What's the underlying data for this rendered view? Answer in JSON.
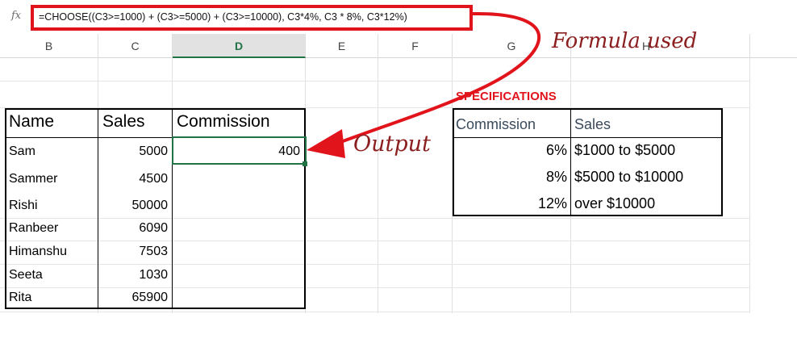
{
  "formula_bar": {
    "fx_label": "fx",
    "formula": "=CHOOSE((C3>=1000) + (C3>=5000) + (C3>=10000), C3*4%, C3 * 8%, C3*12%)"
  },
  "columns": [
    "B",
    "C",
    "D",
    "E",
    "F",
    "G",
    "H"
  ],
  "main_table": {
    "headers": {
      "name": "Name",
      "sales": "Sales",
      "commission": "Commission"
    },
    "rows": [
      {
        "name": "Sam",
        "sales": "5000",
        "commission": "400"
      },
      {
        "name": "Sammer",
        "sales": "4500",
        "commission": ""
      },
      {
        "name": "Rishi",
        "sales": "50000",
        "commission": ""
      },
      {
        "name": "Ranbeer",
        "sales": "6090",
        "commission": ""
      },
      {
        "name": "Himanshu",
        "sales": "7503",
        "commission": ""
      },
      {
        "name": "Seeta",
        "sales": "1030",
        "commission": ""
      },
      {
        "name": "Rita",
        "sales": "65900",
        "commission": ""
      }
    ]
  },
  "specifications": {
    "title": "SPECIFICATIONS",
    "headers": {
      "commission": "Commission",
      "sales": "Sales"
    },
    "rows": [
      {
        "commission": "6%",
        "sales": "$1000 to $5000"
      },
      {
        "commission": "8%",
        "sales": "$5000 to $10000"
      },
      {
        "commission": "12%",
        "sales": "over $10000"
      }
    ]
  },
  "annotations": {
    "formula_used": "Formula used",
    "output": "Output"
  },
  "colors": {
    "highlight_red": "#e1131b",
    "annotation_text": "#8b1e1e",
    "excel_green": "#217346"
  }
}
